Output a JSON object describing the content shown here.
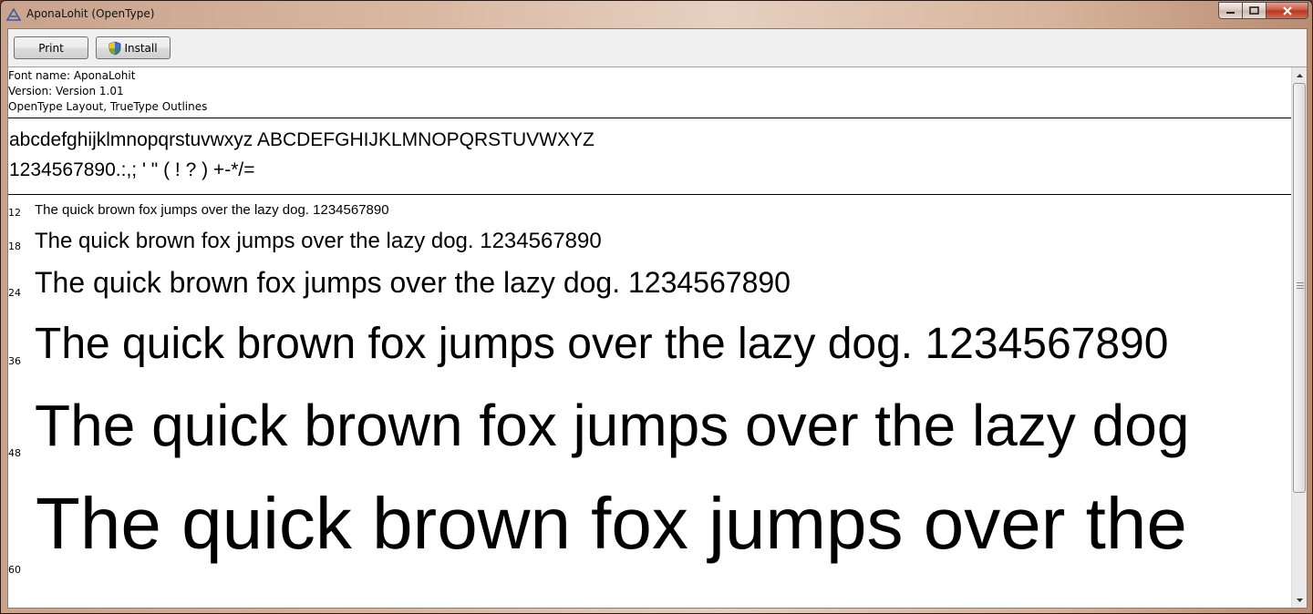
{
  "window": {
    "title": "AponaLohit (OpenType)"
  },
  "toolbar": {
    "print_label": "Print",
    "install_label": "Install"
  },
  "font_info": {
    "name_line": "Font name: AponaLohit",
    "version_line": "Version: Version 1.01",
    "type_line": "OpenType Layout, TrueType Outlines"
  },
  "charset": {
    "letters": "abcdefghijklmnopqrstuvwxyz ABCDEFGHIJKLMNOPQRSTUVWXYZ",
    "digits_symbols": "1234567890.:,; ' \" ( ! ? ) +-*/="
  },
  "samples": [
    {
      "size": "12",
      "text": "The quick brown fox jumps over the lazy dog. 1234567890"
    },
    {
      "size": "18",
      "text": "The quick brown fox jumps over the lazy dog. 1234567890"
    },
    {
      "size": "24",
      "text": "The quick brown fox jumps over the lazy dog. 1234567890"
    },
    {
      "size": "36",
      "text": "The quick brown fox jumps over the lazy dog. 1234567890"
    },
    {
      "size": "48",
      "text": "The quick brown fox jumps over the lazy dog"
    },
    {
      "size": "60",
      "text": "The quick brown fox jumps over the"
    }
  ],
  "colors": {
    "close_button": "#c9533d",
    "window_frame": "#d8b6a0"
  }
}
